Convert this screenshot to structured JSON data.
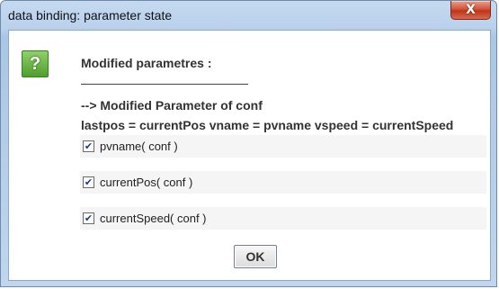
{
  "window": {
    "title": "data binding: parameter state",
    "close_glyph": "X"
  },
  "dialog": {
    "icon": "question-icon",
    "icon_glyph": "?",
    "heading": "Modified parametres :",
    "line1": "--> Modified Parameter of conf",
    "line2": "lastpos = currentPos vname = pvname vspeed = currentSpeed",
    "checkboxes": [
      {
        "label": "pvname( conf )",
        "checked": true
      },
      {
        "label": "currentPos( conf )",
        "checked": true
      },
      {
        "label": "currentSpeed( conf )",
        "checked": true
      }
    ],
    "ok_label": "OK"
  },
  "colors": {
    "title_bar": "#b9d1ec",
    "close_button": "#c0341a",
    "icon_green": "#5aa83a"
  }
}
